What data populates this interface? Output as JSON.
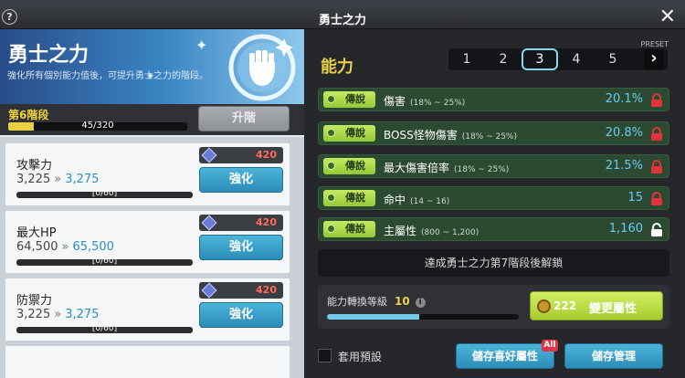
{
  "window": {
    "title": "勇士之力",
    "help_label": "?",
    "close_label": "✕"
  },
  "left": {
    "title": "勇士之力",
    "description": "強化所有個別能力值後，可提升勇士之力的階段。",
    "stage": {
      "label": "第6階段",
      "progress_text": "45/320",
      "progress_value": 45,
      "progress_max": 320
    },
    "upgrade_button": "升階",
    "stats": [
      {
        "name": "攻擊力",
        "current": "3,225",
        "next": "3,275",
        "arrow": "»",
        "progress": "[0/60]",
        "cost": "420",
        "button": "強化"
      },
      {
        "name": "最大HP",
        "current": "64,500",
        "next": "65,500",
        "arrow": "»",
        "progress": "[0/60]",
        "cost": "420",
        "button": "強化"
      },
      {
        "name": "防禦力",
        "current": "3,225",
        "next": "3,275",
        "arrow": "»",
        "progress": "[0/60]",
        "cost": "420",
        "button": "強化"
      }
    ]
  },
  "right": {
    "heading": "能力",
    "preset_label": "PRESET",
    "presets": [
      "1",
      "2",
      "3",
      "4",
      "5"
    ],
    "selected_preset": "3",
    "preset_next": "›",
    "abilities": [
      {
        "rarity": "傳說",
        "name": "傷害",
        "range": "(18% ~ 25%)",
        "value": "20.1%",
        "locked": true
      },
      {
        "rarity": "傳說",
        "name": "BOSS怪物傷害",
        "range": "(18% ~ 25%)",
        "value": "20.8%",
        "locked": true
      },
      {
        "rarity": "傳說",
        "name": "最大傷害倍率",
        "range": "(18% ~ 25%)",
        "value": "21.5%",
        "locked": true
      },
      {
        "rarity": "傳說",
        "name": "命中",
        "range": "(14 ~ 16)",
        "value": "15",
        "locked": true
      },
      {
        "rarity": "傳說",
        "name": "主屬性",
        "range": "(800 ~ 1,200)",
        "value": "1,160",
        "locked": false
      }
    ],
    "unlock_message": "達成勇士之力第7階段後解鎖",
    "conversion": {
      "label": "能力轉換等級",
      "level": "10",
      "info": "i",
      "progress_fraction": 0.48
    },
    "change_button": {
      "cost": "222",
      "label": "變更屬性"
    },
    "use_preset_label": "套用預設",
    "save_favorite_button": "儲存喜好屬性",
    "all_badge": "All",
    "save_manage_button": "儲存管理"
  },
  "colors": {
    "accent_yellow": "#e8d04a",
    "value_blue": "#6bc9ef",
    "cost_red": "#ff6a5a",
    "button_blue": "#2b8db8",
    "rarity_green": "#96c838",
    "lock_red": "#e0343a"
  }
}
